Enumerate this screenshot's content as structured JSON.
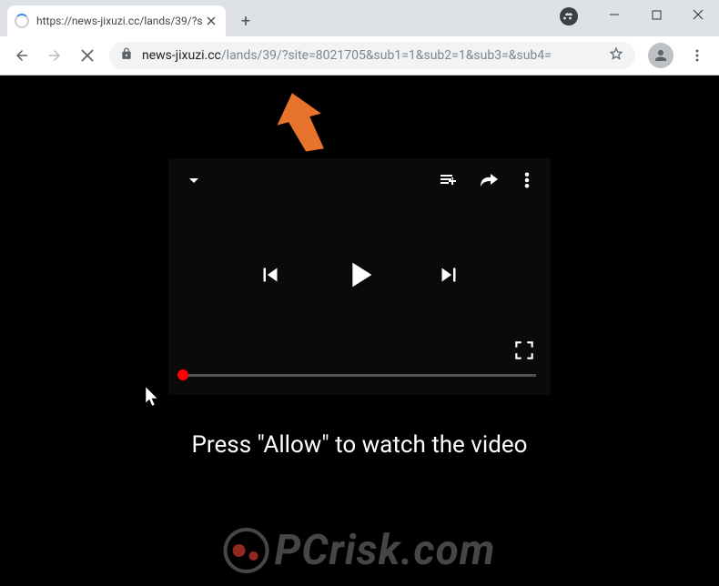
{
  "window": {
    "tab_title": "https://news-jixuzi.cc/lands/39/?s"
  },
  "address_bar": {
    "domain": "news-jixuzi.cc",
    "path": "/lands/39/?site=8021705&sub1=1&sub2=1&sub3=&sub4="
  },
  "page": {
    "instruction": "Press \"Allow\" to watch the video"
  },
  "watermark": {
    "text": "PCrisk.com"
  }
}
